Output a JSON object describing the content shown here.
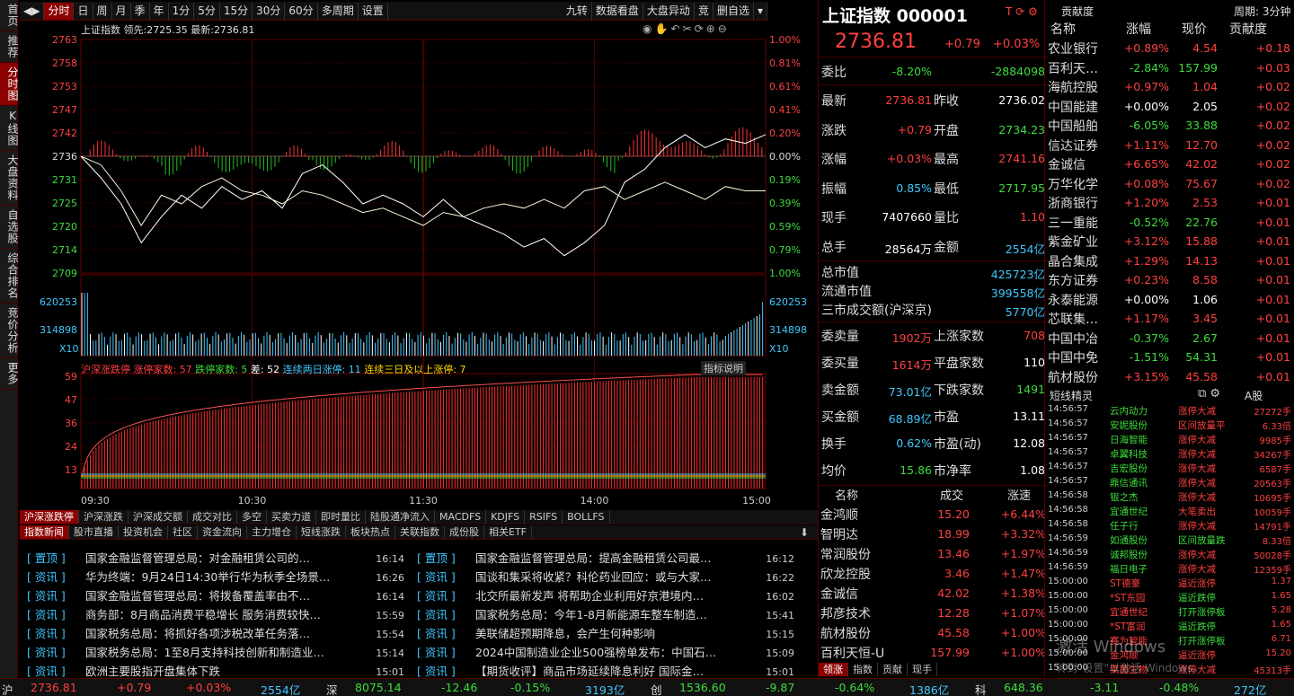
{
  "sidebar": [
    "首页",
    "推荐",
    "分时图",
    "K线图",
    "大盘资料",
    "自选股",
    "综合排名",
    "竞价分析",
    "更多"
  ],
  "topbar": {
    "tabs": [
      "分时",
      "日",
      "周",
      "月",
      "季",
      "年",
      "1分",
      "5分",
      "15分",
      "30分",
      "60分",
      "多周期",
      "设置"
    ],
    "right": [
      "九转",
      "数据看盘",
      "大盘异动",
      "竞",
      "删自选"
    ]
  },
  "chart_header": {
    "name": "上证指数",
    "lead_label": "领先:",
    "lead": "2725.35",
    "latest_label": "最新:",
    "latest": "2736.81"
  },
  "chart_data": [
    {
      "type": "line",
      "name": "上证指数 分时",
      "y_ticks": [
        "2763",
        "2758",
        "2753",
        "2747",
        "2742",
        "2736",
        "2731",
        "2725",
        "2720",
        "2714",
        "2709"
      ],
      "pct_ticks": [
        "1.00%",
        "0.81%",
        "0.61%",
        "0.41%",
        "0.20%",
        "0.00%",
        "0.19%",
        "0.39%",
        "0.59%",
        "0.79%",
        "1.00%"
      ],
      "ylim": [
        2709,
        2763
      ],
      "prev_close": 2736.02,
      "price": [
        2736,
        2731,
        2725,
        2716,
        2722,
        2727,
        2724,
        2729,
        2726,
        2728,
        2724,
        2732,
        2734,
        2730,
        2725,
        2727,
        2725,
        2722,
        2726,
        2722,
        2720,
        2718,
        2715,
        2717,
        2713,
        2716,
        2720,
        2730,
        2733,
        2738,
        2741,
        2738,
        2740,
        2739,
        2741
      ],
      "lead": [
        2736,
        2734,
        2728,
        2720,
        2727,
        2725,
        2729,
        2731,
        2728,
        2727,
        2725,
        2728,
        2727,
        2725,
        2723,
        2724,
        2722,
        2720,
        2723,
        2722,
        2724,
        2725,
        2724,
        2726,
        2724,
        2728,
        2729,
        2726,
        2728,
        2730,
        2728,
        2726,
        2729,
        2728,
        2728
      ]
    },
    {
      "type": "bar",
      "name": "成交量",
      "y_ticks": [
        "620253",
        "314898"
      ],
      "multiplier": "X10"
    },
    {
      "type": "line",
      "name": "沪深涨跌停",
      "y_ticks": [
        "59",
        "47",
        "36",
        "24",
        "13"
      ],
      "limit_up_count": 57,
      "limit_down_count": 5,
      "diff": 52,
      "two_day": 11,
      "three_day": 7,
      "x_ticks": [
        "09:30",
        "10:30",
        "11:30",
        "14:00",
        "15:00"
      ]
    }
  ],
  "limit_header": {
    "label": "沪深涨跌停",
    "up": "涨停家数: 57",
    "down": "跌停家数: 5",
    "diff": "差: 52",
    "two": "连续两日涨停: 11",
    "three": "连续三日及以上涨停: 7",
    "explain": "指标说明"
  },
  "indicator_tabs": [
    "沪深涨跌停",
    "沪深涨跌",
    "沪深成交额",
    "成交对比",
    "多空",
    "买卖力道",
    "即时量比",
    "陆股通净流入",
    "MACDFS",
    "KDJFS",
    "RSIFS",
    "BOLLFS"
  ],
  "news_tabs": [
    "指数新闻",
    "股市直播",
    "投资机会",
    "社区",
    "资金流向",
    "主力增仓",
    "短线涨跌",
    "板块热点",
    "关联指数",
    "成份股",
    "相关ETF"
  ],
  "news_left": [
    {
      "tag": "[ 置顶 ]",
      "title": "国家金融监督管理总局：对金融租赁公司的…",
      "time": "16:14"
    },
    {
      "tag": "[ 资讯 ]",
      "title": "华为终端：9月24日14:30举行华为秋季全场景…",
      "time": "16:26"
    },
    {
      "tag": "[ 资讯 ]",
      "title": "国家金融监督管理总局：将拨备覆盖率由不…",
      "time": "16:14"
    },
    {
      "tag": "[ 资讯 ]",
      "title": "商务部：8月商品消费平稳增长 服务消费较快…",
      "time": "15:59"
    },
    {
      "tag": "[ 资讯 ]",
      "title": "国家税务总局：将抓好各项涉税改革任务落…",
      "time": "15:54"
    },
    {
      "tag": "[ 资讯 ]",
      "title": "国家税务总局：1至8月支持科技创新和制造业…",
      "time": "15:14"
    },
    {
      "tag": "[ 资讯 ]",
      "title": "欧洲主要股指开盘集体下跌",
      "time": "15:01"
    }
  ],
  "news_right": [
    {
      "tag": "[ 置顶 ]",
      "title": "国家金融监督管理总局：提高金融租赁公司最…",
      "time": "16:12"
    },
    {
      "tag": "[ 资讯 ]",
      "title": "国谈和集采将收紧？科伦药业回应：或与大家…",
      "time": "16:22"
    },
    {
      "tag": "[ 资讯 ]",
      "title": "北交所最新发声 将帮助企业利用好京港境内…",
      "time": "16:02"
    },
    {
      "tag": "[ 资讯 ]",
      "title": "国家税务总局：今年1-8月新能源车整车制造…",
      "time": "15:41"
    },
    {
      "tag": "[ 资讯 ]",
      "title": "美联储超预期降息，会产生何种影响",
      "time": "15:15"
    },
    {
      "tag": "[ 资讯 ]",
      "title": "2024中国制造业企业500强榜单发布：中国石…",
      "time": "15:09"
    },
    {
      "tag": "[ 资讯 ]",
      "title": "【期货收评】商品市场延续降息利好 国际金…",
      "time": "15:01"
    }
  ],
  "quote": {
    "title": "上证指数 000001",
    "price": "2736.81",
    "chg": "+0.79",
    "pct": "+0.03%",
    "weibi_label": "委比",
    "weibi": "-8.20%",
    "weicha": "-2884098",
    "rows": [
      [
        "最新",
        "2736.81",
        "red",
        "昨收",
        "2736.02",
        "wht"
      ],
      [
        "涨跌",
        "+0.79",
        "red",
        "开盘",
        "2734.23",
        "grn"
      ],
      [
        "涨幅",
        "+0.03%",
        "red",
        "最高",
        "2741.16",
        "red"
      ],
      [
        "振幅",
        "0.85%",
        "cyan",
        "最低",
        "2717.95",
        "grn"
      ],
      [
        "现手",
        "7407660",
        "wht",
        "量比",
        "1.10",
        "red"
      ],
      [
        "总手",
        "28564万",
        "wht",
        "金额",
        "2554亿",
        "cyan"
      ]
    ],
    "mkt": [
      [
        "总市值",
        "425723亿"
      ],
      [
        "流通市值",
        "399558亿"
      ],
      [
        "三市成交额(沪深京)",
        "5770亿"
      ]
    ],
    "rows2": [
      [
        "委卖量",
        "1902万",
        "red",
        "上涨家数",
        "708",
        "red"
      ],
      [
        "委买量",
        "1614万",
        "red",
        "平盘家数",
        "110",
        "wht"
      ],
      [
        "卖金额",
        "73.01亿",
        "cyan",
        "下跌家数",
        "1491",
        "grn"
      ],
      [
        "买金额",
        "68.89亿",
        "cyan",
        "市盈",
        "13.11",
        "wht"
      ],
      [
        "换手",
        "0.62%",
        "cyan",
        "市盈(动)",
        "12.08",
        "wht"
      ],
      [
        "均价",
        "15.86",
        "grn",
        "市净率",
        "1.08",
        "wht"
      ]
    ]
  },
  "leaders": {
    "headers": [
      "名称",
      "成交",
      "涨速"
    ],
    "rows": [
      [
        "金鸿顺",
        "15.20",
        "+6.44%"
      ],
      [
        "智明达",
        "18.99",
        "+3.32%"
      ],
      [
        "常润股份",
        "13.46",
        "+1.97%"
      ],
      [
        "欣龙控股",
        "3.46",
        "+1.47%"
      ],
      [
        "金诚信",
        "42.02",
        "+1.38%"
      ],
      [
        "邦彦技术",
        "12.28",
        "+1.07%"
      ],
      [
        "航材股份",
        "45.58",
        "+1.00%"
      ],
      [
        "百利天恒-U",
        "157.99",
        "+1.00%"
      ]
    ],
    "tabs": [
      "领涨",
      "指数",
      "贡献",
      "现手"
    ]
  },
  "contrib": {
    "title": "贡献度",
    "period": "周期: 3分钟",
    "headers": [
      "名称",
      "涨幅",
      "现价",
      "贡献度"
    ],
    "rows": [
      [
        "农业银行",
        "+0.89%",
        "4.54",
        "+0.18",
        "red"
      ],
      [
        "百利天…",
        "-2.84%",
        "157.99",
        "+0.03",
        "grn"
      ],
      [
        "海航控股",
        "+0.97%",
        "1.04",
        "+0.02",
        "red"
      ],
      [
        "中国能建",
        "+0.00%",
        "2.05",
        "+0.02",
        "wht"
      ],
      [
        "中国船舶",
        "-6.05%",
        "33.88",
        "+0.02",
        "grn"
      ],
      [
        "信达证券",
        "+1.11%",
        "12.70",
        "+0.02",
        "red"
      ],
      [
        "金诚信",
        "+6.65%",
        "42.02",
        "+0.02",
        "red"
      ],
      [
        "万华化学",
        "+0.08%",
        "75.67",
        "+0.02",
        "red"
      ],
      [
        "浙商银行",
        "+1.20%",
        "2.53",
        "+0.01",
        "red"
      ],
      [
        "三一重能",
        "-0.52%",
        "22.76",
        "+0.01",
        "grn"
      ],
      [
        "紫金矿业",
        "+3.12%",
        "15.88",
        "+0.01",
        "red"
      ],
      [
        "晶合集成",
        "+1.29%",
        "14.13",
        "+0.01",
        "red"
      ],
      [
        "东方证券",
        "+0.23%",
        "8.58",
        "+0.01",
        "red"
      ],
      [
        "永泰能源",
        "+0.00%",
        "1.06",
        "+0.01",
        "wht"
      ],
      [
        "芯联集…",
        "+1.17%",
        "3.45",
        "+0.01",
        "red"
      ],
      [
        "中国中冶",
        "-0.37%",
        "2.67",
        "+0.01",
        "grn"
      ],
      [
        "中国中免",
        "-1.51%",
        "54.31",
        "+0.01",
        "grn"
      ],
      [
        "航材股份",
        "+3.15%",
        "45.58",
        "+0.01",
        "red"
      ]
    ]
  },
  "shortline": {
    "title": "短线精灵",
    "market": "A股",
    "rows": [
      [
        "14:56:57",
        "云内动力",
        "涨停大减",
        "27272手"
      ],
      [
        "14:56:57",
        "安妮股份",
        "区间放量平",
        "6.33倍"
      ],
      [
        "14:56:57",
        "日海智能",
        "涨停大减",
        "9985手"
      ],
      [
        "14:56:57",
        "卓翼科技",
        "涨停大减",
        "34267手"
      ],
      [
        "14:56:57",
        "吉宏股份",
        "涨停大减",
        "6587手"
      ],
      [
        "14:56:57",
        "鼎信通讯",
        "涨停大减",
        "20563手"
      ],
      [
        "14:56:58",
        "银之杰",
        "涨停大减",
        "10695手"
      ],
      [
        "14:56:58",
        "宜通世纪",
        "大笔卖出",
        "10059手"
      ],
      [
        "14:56:58",
        "任子行",
        "涨停大减",
        "14791手"
      ],
      [
        "14:56:59",
        "如通股份",
        "区间放量跌",
        "8.33倍"
      ],
      [
        "14:56:59",
        "诚邦股份",
        "涨停大减",
        "50028手"
      ],
      [
        "14:56:59",
        "福日电子",
        "涨停大减",
        "12359手"
      ],
      [
        "15:00:00",
        "ST德豪",
        "逼近涨停",
        "1.37"
      ],
      [
        "15:00:00",
        "*ST东园",
        "逼近跌停",
        "1.65"
      ],
      [
        "15:00:00",
        "宜通世纪",
        "打开涨停板",
        "5.28"
      ],
      [
        "15:00:00",
        "*ST富润",
        "逼近跌停",
        "1.65"
      ],
      [
        "15:00:00",
        "赛为智能",
        "打开涨停板",
        "6.71"
      ],
      [
        "15:00:00",
        "金鸿顺",
        "逼近涨停",
        "15.20"
      ],
      [
        "15:00:00",
        "莱茵生物",
        "涨停大减",
        "45313手"
      ]
    ]
  },
  "statusbar": [
    {
      "m": "沪",
      "p": "2736.81",
      "c": "+0.79",
      "pct": "+0.03%",
      "amt": "2554亿"
    },
    {
      "m": "深",
      "p": "8075.14",
      "c": "-12.46",
      "pct": "-0.15%",
      "amt": "3193亿"
    },
    {
      "m": "创",
      "p": "1536.60",
      "c": "-9.87",
      "pct": "-0.64%",
      "amt": "1386亿"
    },
    {
      "m": "科",
      "p": "648.36",
      "c": "-3.11",
      "pct": "-0.48%",
      "amt": "272亿"
    }
  ],
  "watermark": "激活 Windows",
  "watermark2": "转到\"设置\"以激活 Windows。"
}
